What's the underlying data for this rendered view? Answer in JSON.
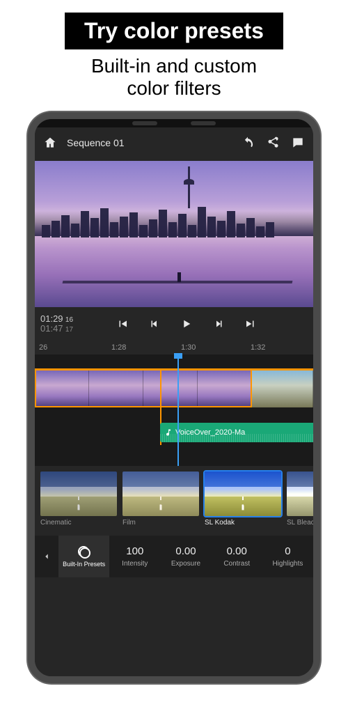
{
  "promo": {
    "headline": "Try color presets",
    "subline1": "Built-in and custom",
    "subline2": "color filters"
  },
  "header": {
    "title": "Sequence 01"
  },
  "playback": {
    "current_tc": "01:29",
    "current_frames": "16",
    "total_tc": "01:47",
    "total_frames": "17"
  },
  "ruler": {
    "t0": "26",
    "t1": "1:28",
    "t2": "1:30",
    "t3": "1:32"
  },
  "audio": {
    "clip_name": "VoiceOver_2020-Ma"
  },
  "presets": {
    "p0": "Cinematic",
    "p1": "Film",
    "p2": "SL Kodak",
    "p3": "SL Bleac"
  },
  "tools": {
    "presets_label": "Built-In Presets",
    "intensity_label": "Intensity",
    "intensity_value": "100",
    "exposure_label": "Exposure",
    "exposure_value": "0.00",
    "contrast_label": "Contrast",
    "contrast_value": "0.00",
    "highlights_label": "Highlights",
    "highlights_value": "0"
  }
}
